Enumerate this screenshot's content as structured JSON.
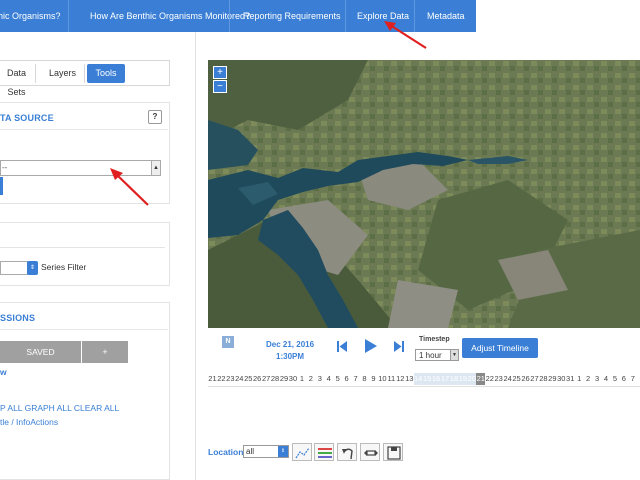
{
  "nav": {
    "items": [
      {
        "label": "hic Organisms?"
      },
      {
        "label": "How Are Benthic Organisms Monitored?"
      },
      {
        "label": "Reporting Requirements"
      },
      {
        "label": "Explore Data"
      },
      {
        "label": "Metadata"
      }
    ],
    "color": "#3a7fd5"
  },
  "sidebar": {
    "tabs": [
      {
        "label": "Data Sets"
      },
      {
        "label": "Layers"
      },
      {
        "label": "Tools",
        "active": true
      }
    ],
    "data_source": {
      "title": "TA SOURCE",
      "help_label": "?",
      "select_value": "--"
    },
    "series": {
      "filter_label": "Series Filter"
    },
    "sessions": {
      "title": "SSIONS",
      "saved_label": "SAVED",
      "add_label": "+",
      "view_link": "w",
      "graph_actions": "P ALL GRAPH ALL CLEAR ALL",
      "info_actions": "tle / InfoActions"
    }
  },
  "map": {
    "zoom_in": "+",
    "zoom_out": "−"
  },
  "timeline": {
    "north_label": "N",
    "date": "Dec 21, 2016",
    "time": "1:30PM",
    "timestep_label": "Timestep",
    "timestep_value": "1 hour",
    "adjust_label": "Adjust Timeline",
    "hours": [
      "21",
      "22",
      "23",
      "24",
      "25",
      "26",
      "27",
      "28",
      "29",
      "30",
      "1",
      "2",
      "3",
      "4",
      "5",
      "6",
      "7",
      "8",
      "9",
      "10",
      "11",
      "12",
      "13",
      "14",
      "15",
      "16",
      "17",
      "18",
      "19",
      "20",
      "21",
      "22",
      "23",
      "24",
      "25",
      "26",
      "27",
      "28",
      "29",
      "30",
      "31",
      "1",
      "2",
      "3",
      "4",
      "5",
      "6",
      "7"
    ]
  },
  "location": {
    "label": "Location",
    "value": "all"
  },
  "icons": {
    "draw": "draw-line-icon",
    "legend": "legend-icon",
    "undo": "undo-icon",
    "pan": "pan-icon",
    "save": "save-icon"
  },
  "annotation_color": "#e02020"
}
